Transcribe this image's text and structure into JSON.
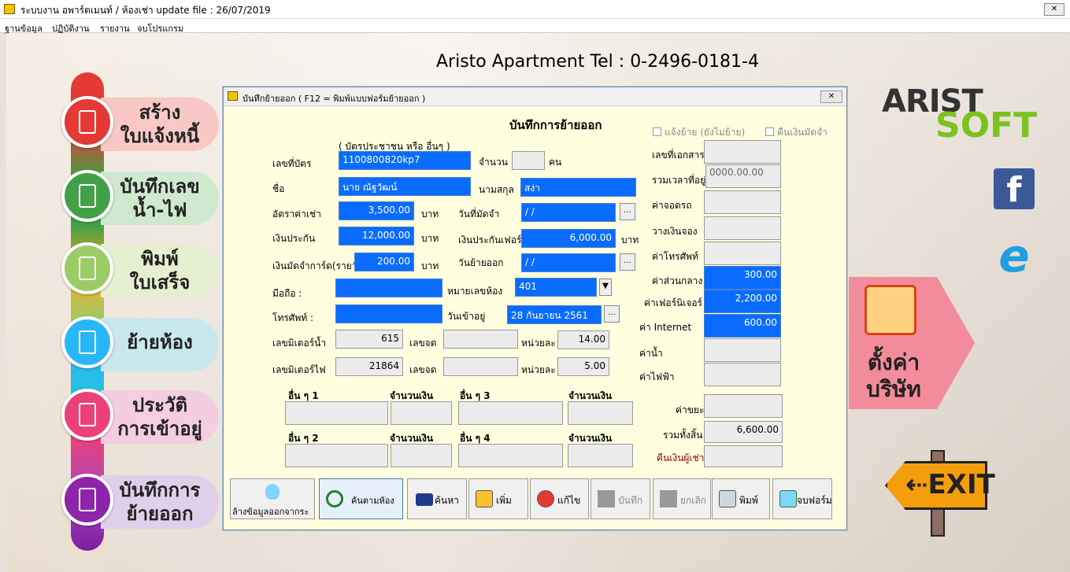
{
  "window": {
    "title": "ระบบงาน อพาร์ตเมนท์ / ห้องเช่า update file : 26/07/2019",
    "close": "✕"
  },
  "menu": [
    "ฐานข้อมูล",
    "ปฏิบัติงาน",
    "รายงาน",
    "จบโปรแกรม"
  ],
  "header": {
    "text": "Aristo Apartment   Tel : 0-2496-0181-4"
  },
  "sidebar": {
    "items": [
      {
        "label": "สร้าง\nใบแจ้งหนี้",
        "icon": "invoice-icon",
        "color": "#e53935",
        "pill": "#f8c9c4"
      },
      {
        "label": "บันทึกเลข\nน้ำ-ไฟ",
        "icon": "meter-icon",
        "color": "#43a047",
        "pill": "#cfe9cf"
      },
      {
        "label": "พิมพ์\nใบเสร็จ",
        "icon": "receipt-icon",
        "color": "#9ccc65",
        "pill": "#e6efcf"
      },
      {
        "label": "ย้ายห้อง",
        "icon": "person-icon",
        "color": "#29b6f6",
        "pill": "#c8e8ee"
      },
      {
        "label": "ประวัติ\nการเข้าอยู่",
        "icon": "history-icon",
        "color": "#ec407a",
        "pill": "#f4cde0"
      },
      {
        "label": "บันทึกการ\nย้ายออก",
        "icon": "moving-truck-icon",
        "color": "#8e24aa",
        "pill": "#e0cfea"
      }
    ]
  },
  "logo": {
    "line1": "ARIST",
    "line2": "SOFT"
  },
  "social": {
    "facebook": "f",
    "ie": "e"
  },
  "settings": {
    "label": "ตั้งค่า\nบริษัท"
  },
  "exit": {
    "label": "EXIT"
  },
  "dialog": {
    "title": "บันทึกย้ายออก ( F12 = พิมพ์แบบฟอร์มย้ายออก )",
    "close": "✕",
    "heading": "บันทึกการย้ายออก",
    "id_hint": "( บัตรประชาชน หรือ อื่นๆ )",
    "fields": {
      "card_no": {
        "label": "เลขที่บัตร",
        "value": "1100800820kp7"
      },
      "count": {
        "label": "จำนวน",
        "value": "",
        "unit": "คน"
      },
      "name": {
        "label": "ชื่อ",
        "value": "นาย ณัฐวัฒน์"
      },
      "surname": {
        "label": "นามสกุล",
        "value": "สง่า"
      },
      "rent": {
        "label": "อัตราค่าเช่า",
        "value": "3,500.00",
        "unit": "บาท"
      },
      "deposit_date": {
        "label": "วันที่มัดจำ",
        "value": "  /  /"
      },
      "insurance": {
        "label": "เงินประกัน",
        "value": "12,000.00",
        "unit": "บาท"
      },
      "furniture_ins": {
        "label": "เงินประกันเฟอร์นิเจอร์",
        "value": "6,000.00",
        "unit": "บาท"
      },
      "card_deposit": {
        "label": "เงินมัดจำการ์ด(รายวัน)",
        "value": "200.00",
        "unit": "บาท"
      },
      "move_out_date": {
        "label": "วันย้ายออก",
        "value": "  /  /"
      },
      "mobile": {
        "label": "มือถือ :",
        "value": ""
      },
      "room": {
        "label": "หมายเลขห้อง",
        "value": "401"
      },
      "phone": {
        "label": "โทรศัพท์ :",
        "value": ""
      },
      "move_in": {
        "label": "วันเข้าอยู่",
        "value": "28 กันยายน 2561"
      },
      "water_meter": {
        "label": "เลขมิเตอร์น้ำ",
        "value": "615",
        "read_label": "เลขจด",
        "read": "",
        "rate_label": "หน่วยละ",
        "rate": "14.00"
      },
      "elec_meter": {
        "label": "เลขมิเตอร์ไฟ",
        "value": "21864",
        "read_label": "เลขจด",
        "read": "",
        "rate_label": "หน่วยละ",
        "rate": "5.00"
      }
    },
    "others": {
      "o1": "อื่น ๆ 1",
      "o2": "อื่น ๆ 2",
      "o3": "อื่น ๆ 3",
      "o4": "อื่น ๆ 4",
      "amount": "จำนวนเงิน"
    },
    "right": {
      "chk_notify": "แจ้งย้าย (ยังไม่ย้าย)",
      "chk_refund": "คืนเงินมัดจำ",
      "doc_no": {
        "label": "เลขที่เอกสาร",
        "value": ""
      },
      "stay_time": {
        "label": "รวมเวลาที่อยู่",
        "value": "0000.00.00"
      },
      "parking": {
        "label": "ค่าจอดรถ",
        "value": ""
      },
      "booking": {
        "label": "วางเงินจอง",
        "value": ""
      },
      "telephone": {
        "label": "ค่าโทรศัพท์",
        "value": ""
      },
      "common": {
        "label": "ค่าส่วนกลาง",
        "value": "300.00"
      },
      "furniture": {
        "label": "ค่าเฟอร์นิเจอร์",
        "value": "2,200.00"
      },
      "internet": {
        "label": "ค่า Internet",
        "value": "600.00"
      },
      "water": {
        "label": "ค่าน้ำ",
        "value": ""
      },
      "electric": {
        "label": "ค่าไฟฟ้า",
        "value": ""
      },
      "garbage": {
        "label": "ค่าขยะ",
        "value": ""
      },
      "total": {
        "label": "รวมทั้งสิ้น",
        "value": "6,600.00"
      },
      "refund": {
        "label": "คืนเงินผู้เช่า",
        "value": ""
      }
    },
    "buttons": {
      "clear": "ล้างข้อมูลออกจากระ",
      "search_room": "ค้นตามห้อง",
      "search": "ค้นหา",
      "add": "เพิ่ม",
      "edit": "แก้ไข",
      "save": "บันทึก",
      "cancel": "ยกเลิก",
      "print": "พิมพ์",
      "close": "จบฟอร์ม"
    }
  }
}
